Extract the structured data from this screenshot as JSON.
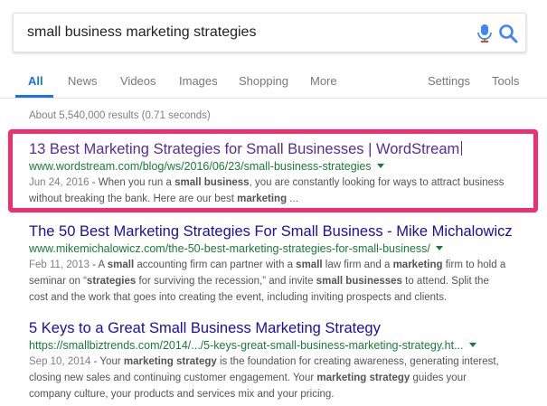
{
  "search": {
    "query": "small business marketing strategies"
  },
  "tabs": [
    "All",
    "News",
    "Videos",
    "Images",
    "Shopping",
    "More"
  ],
  "tools": {
    "settings": "Settings",
    "tools": "Tools"
  },
  "stats": "About 5,540,000 results (0.71 seconds)",
  "results": [
    {
      "title": "13 Best Marketing Strategies for Small Businesses | WordStream",
      "url": "www.wordstream.com/blog/ws/2016/06/23/small-business-strategies",
      "date": "Jun 24, 2016",
      "snippet": [
        [
          " - When you run a ",
          "n"
        ],
        [
          "small business",
          "b"
        ],
        [
          ", you are constantly looking for ways to attract business",
          "n"
        ],
        [
          "without breaking the bank. Here are our best ",
          "n"
        ],
        [
          "marketing",
          "b"
        ],
        [
          " ...",
          "n"
        ]
      ]
    },
    {
      "title": "The 50 Best Marketing Strategies For Small Business - Mike Michalowicz",
      "url": "www.mikemichalowicz.com/the-50-best-marketing-strategies-for-small-business/",
      "date": "Feb 11, 2013",
      "snippet": [
        [
          " - A ",
          "n"
        ],
        [
          "small",
          "b"
        ],
        [
          " accounting firm can partner with a ",
          "n"
        ],
        [
          "small",
          "b"
        ],
        [
          " law firm and a ",
          "n"
        ],
        [
          "marketing",
          "b"
        ],
        [
          " firm to hold a",
          "n"
        ],
        [
          "seminar on “",
          "n"
        ],
        [
          "strategies",
          "b"
        ],
        [
          " for surviving the recession,” and invite ",
          "n"
        ],
        [
          "small businesses",
          "b"
        ],
        [
          " to attend. Split the",
          "n"
        ],
        [
          "cost and the work that goes into creating the event, including inviting prospects and clients.",
          "n"
        ]
      ]
    },
    {
      "title": "5 Keys to a Great Small Business Marketing Strategy",
      "url": "https://smallbiztrends.com/2014/.../5-keys-great-small-business-marketing-strategy.ht...",
      "date": "Sep 10, 2014",
      "snippet": [
        [
          " - Your ",
          "n"
        ],
        [
          "marketing strategy",
          "b"
        ],
        [
          " is the foundation for creating awareness, generating interest,",
          "n"
        ],
        [
          "closing new sales and continuing customer engagement. Your ",
          "n"
        ],
        [
          "marketing strategy",
          "b"
        ],
        [
          " guides your",
          "n"
        ],
        [
          "company culture, your products and services mix and your pricing.",
          "n"
        ]
      ]
    }
  ]
}
